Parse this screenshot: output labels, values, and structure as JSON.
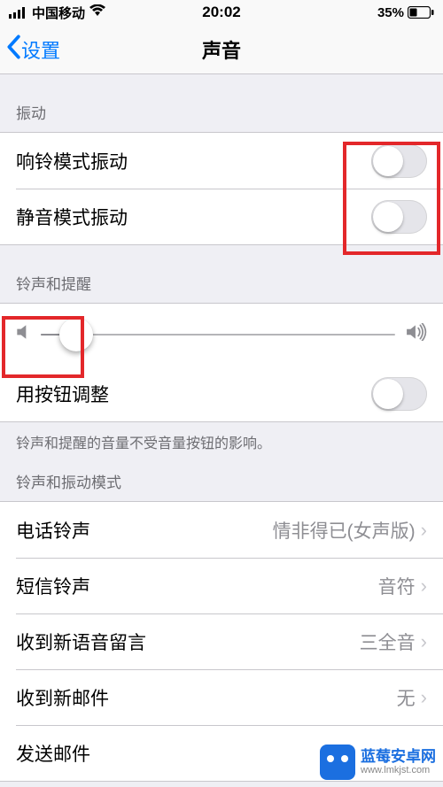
{
  "status": {
    "carrier": "中国移动",
    "time": "20:02",
    "battery_pct": "35%"
  },
  "nav": {
    "back_label": "设置",
    "title": "声音"
  },
  "sections": {
    "vibration": {
      "header": "振动",
      "ring_vibrate_label": "响铃模式振动",
      "silent_vibrate_label": "静音模式振动"
    },
    "ringer": {
      "header": "铃声和提醒",
      "button_adjust_label": "用按钮调整",
      "footer": "铃声和提醒的音量不受音量按钮的影响。",
      "slider_value_pct": 10
    },
    "patterns": {
      "header": "铃声和振动模式",
      "items": [
        {
          "label": "电话铃声",
          "value": "情非得已(女声版)"
        },
        {
          "label": "短信铃声",
          "value": "音符"
        },
        {
          "label": "收到新语音留言",
          "value": "三全音"
        },
        {
          "label": "收到新邮件",
          "value": "无"
        },
        {
          "label": "发送邮件",
          "value": ""
        }
      ]
    }
  },
  "watermark": {
    "line1": "蓝莓安卓网",
    "line2": "www.lmkjst.com"
  }
}
